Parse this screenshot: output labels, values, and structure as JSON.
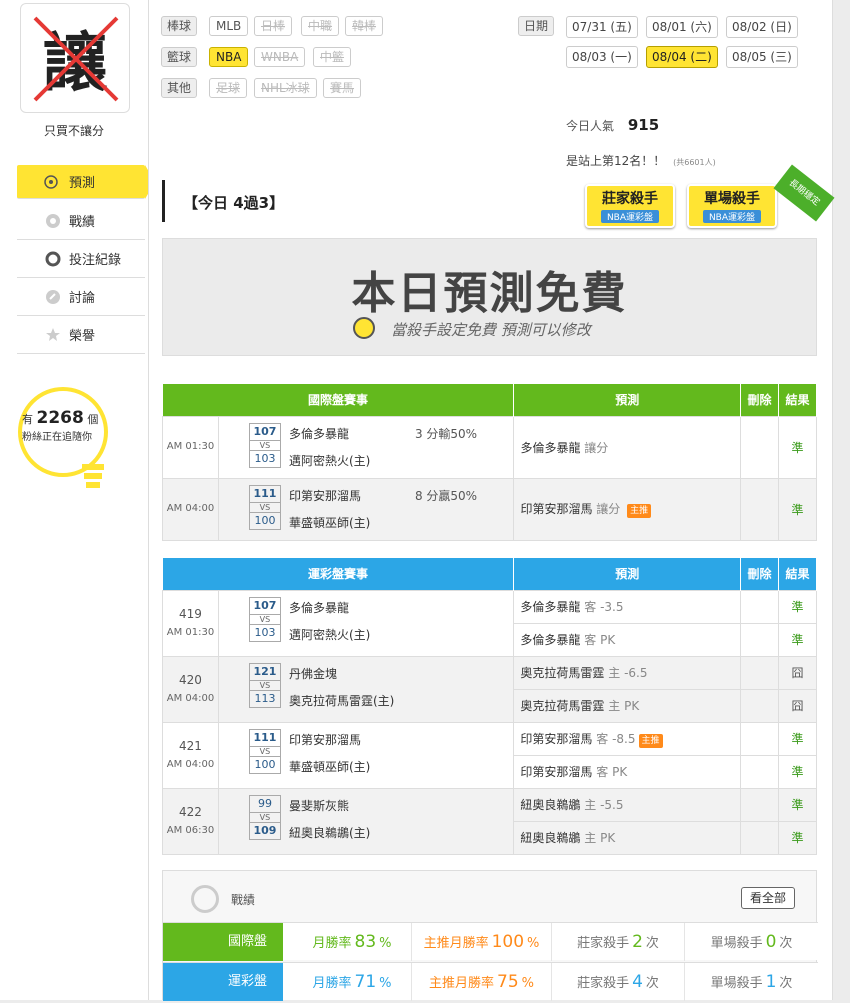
{
  "sidebar": {
    "avatar_char": "讓",
    "username": "只買不讓分",
    "nav": [
      {
        "label": "預測"
      },
      {
        "label": "戰績"
      },
      {
        "label": "投注紀錄"
      },
      {
        "label": "討論"
      },
      {
        "label": "榮譽"
      }
    ],
    "fans_prefix": "有",
    "fans_count": "2268",
    "fans_unit": "個",
    "fans_text": "粉絲正在追隨你"
  },
  "filters": {
    "baseball_label": "棒球",
    "baseball": [
      "MLB",
      "日棒",
      "中職",
      "韓棒"
    ],
    "basketball_label": "籃球",
    "basketball": [
      "NBA",
      "WNBA",
      "中籃"
    ],
    "other_label": "其他",
    "other": [
      "足球",
      "NHL冰球",
      "賽馬"
    ]
  },
  "dates": {
    "label": "日期",
    "items": [
      "07/31 (五)",
      "08/01 (六)",
      "08/02 (日)",
      "08/03 (一)",
      "08/04 (二)",
      "08/05 (三)"
    ],
    "selected": "08/04 (二)"
  },
  "stats": {
    "popularity_label": "今日人氣",
    "popularity": "915",
    "rank_text": "是站上第12名！！",
    "rank_sub": "(共6601人)"
  },
  "today": "【今日 4過3】",
  "badges": {
    "banker_killer": "莊家殺手",
    "banker_sub": "NBA運彩盤",
    "single_killer": "單場殺手",
    "single_sub": "NBA運彩盤",
    "ribbon": "長期穩定"
  },
  "banner": {
    "title": "本日預測免費",
    "sub": "當殺手設定免費  預測可以修改"
  },
  "intl_table": {
    "headers": [
      "國際盤賽事",
      "預測",
      "刪除",
      "結果"
    ],
    "rows": [
      {
        "time": "AM 01:30",
        "away_score": "107",
        "home_score": "103",
        "away": "多倫多暴龍",
        "home": "邁阿密熱火(主)",
        "spread": "3 分輸50%",
        "pick": "多倫多暴龍",
        "pick_type": "讓分",
        "main": "",
        "result": "準"
      },
      {
        "time": "AM 04:00",
        "away_score": "111",
        "home_score": "100",
        "away": "印第安那溜馬",
        "home": "華盛頓巫師(主)",
        "spread": "8 分贏50%",
        "pick": "印第安那溜馬",
        "pick_type": "讓分",
        "main": "主推",
        "result": "準"
      }
    ]
  },
  "lottery_table": {
    "headers": [
      "運彩盤賽事",
      "預測",
      "刪除",
      "結果"
    ],
    "games": [
      {
        "no": "419",
        "time": "AM 01:30",
        "away_score": "107",
        "home_score": "103",
        "away": "多倫多暴龍",
        "home": "邁阿密熱火(主)",
        "picks": [
          {
            "team": "多倫多暴龍",
            "line": "客 -3.5",
            "main": "",
            "result": "準"
          },
          {
            "team": "多倫多暴龍",
            "line": "客 PK",
            "main": "",
            "result": "準"
          }
        ]
      },
      {
        "no": "420",
        "time": "AM 04:00",
        "away_score": "121",
        "home_score": "113",
        "away": "丹佛金塊",
        "home": "奧克拉荷馬雷霆(主)",
        "picks": [
          {
            "team": "奧克拉荷馬雷霆",
            "line": "主 -6.5",
            "main": "",
            "result": "囧"
          },
          {
            "team": "奧克拉荷馬雷霆",
            "line": "主 PK",
            "main": "",
            "result": "囧"
          }
        ]
      },
      {
        "no": "421",
        "time": "AM 04:00",
        "away_score": "111",
        "home_score": "100",
        "away": "印第安那溜馬",
        "home": "華盛頓巫師(主)",
        "picks": [
          {
            "team": "印第安那溜馬",
            "line": "客 -8.5",
            "main": "主推",
            "result": "準"
          },
          {
            "team": "印第安那溜馬",
            "line": "客 PK",
            "main": "",
            "result": "準"
          }
        ]
      },
      {
        "no": "422",
        "time": "AM 06:30",
        "away_score": "99",
        "home_score": "109",
        "away": "曼斐斯灰熊",
        "home": "紐奧良鵜鶘(主)",
        "picks": [
          {
            "team": "紐奧良鵜鶘",
            "line": "主 -5.5",
            "main": "",
            "result": "準"
          },
          {
            "team": "紐奧良鵜鶘",
            "line": "主 PK",
            "main": "",
            "result": "準"
          }
        ]
      }
    ]
  },
  "record": {
    "title": "戰績",
    "view_all": "看全部",
    "rows": [
      {
        "type": "國際盤",
        "month_label": "月勝率",
        "month": "83",
        "main_label": "主推月勝率",
        "main": "100",
        "banker_label": "莊家殺手",
        "banker": "2",
        "single_label": "單場殺手",
        "single": "0",
        "unit": "次",
        "pct": "%"
      },
      {
        "type": "運彩盤",
        "month_label": "月勝率",
        "month": "71",
        "main_label": "主推月勝率",
        "main": "75",
        "banker_label": "莊家殺手",
        "banker": "4",
        "single_label": "單場殺手",
        "single": "1",
        "unit": "次",
        "pct": "%"
      }
    ]
  },
  "colors": {
    "yellow": "#ffe433",
    "green": "#63b91d",
    "blue": "#2ca6e6",
    "orange": "#ff8a1a"
  },
  "icons": [
    "target-icon",
    "record-icon",
    "bet-record-icon",
    "discussion-icon",
    "honor-icon",
    "lightbulb-icon"
  ]
}
